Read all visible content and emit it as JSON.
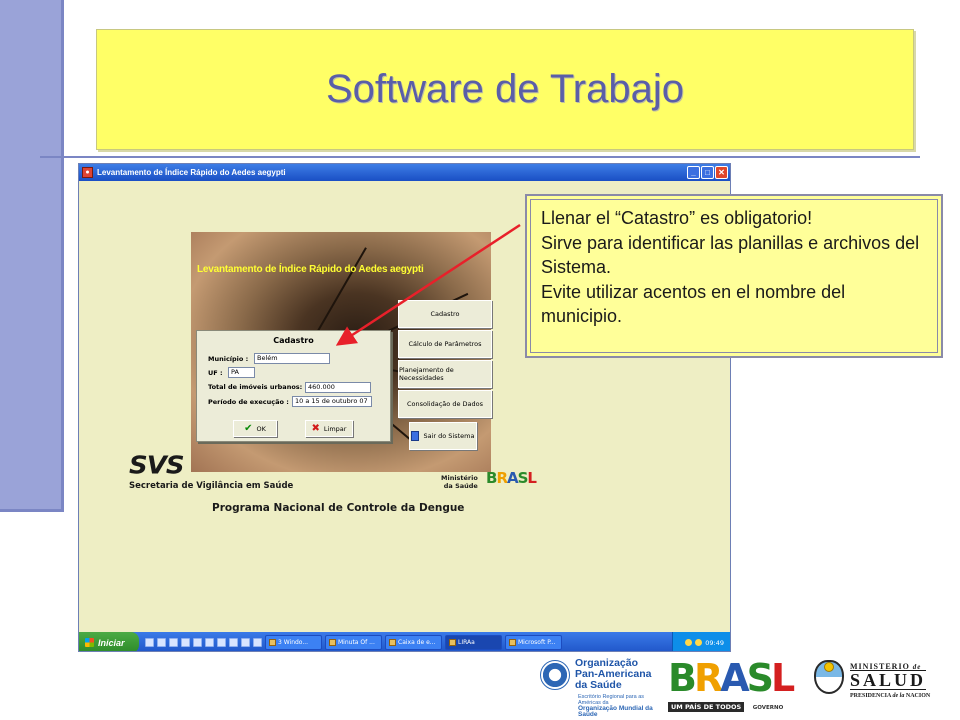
{
  "slide": {
    "title": "Software de Trabajo"
  },
  "window": {
    "title": "Levantamento de Índice Rápido do Aedes aegypti",
    "controls": {
      "minimize": "_",
      "maximize": "□",
      "close": "✕"
    }
  },
  "app": {
    "photo_title": "Levantamento de Índice Rápido do Aedes aegypti",
    "menu": [
      {
        "label": "Cadastro"
      },
      {
        "label": "Cálculo de Parâmetros"
      },
      {
        "label": "Planejamento de Necessidades"
      },
      {
        "label": "Consolidação de Dados"
      },
      {
        "label": "Sair do Sistema"
      }
    ],
    "dialog": {
      "title": "Cadastro",
      "fields": [
        {
          "label": "Município :",
          "value": "Belém"
        },
        {
          "label": "UF :",
          "value": "PA"
        },
        {
          "label": "Total de imóveis urbanos:",
          "value": "460.000"
        },
        {
          "label": "Período de execução :",
          "value": "10 a 15 de outubro 07"
        }
      ],
      "ok_label": "OK",
      "clear_label": "Limpar"
    },
    "svs_logo": "SVS",
    "svs_subtitle": "Secretaria de Vigilância em Saúde",
    "ministerio": [
      "Ministério",
      "da Saúde"
    ],
    "brasil_small": "BRASL",
    "program": "Programa Nacional de Controle da Dengue"
  },
  "taskbar": {
    "start_label": "Iniciar",
    "tasks": [
      {
        "label": "3 Windo..."
      },
      {
        "label": "Minuta Of ..."
      },
      {
        "label": "Caixa de e..."
      },
      {
        "label": "LIRAa"
      },
      {
        "label": "Microsoft P..."
      }
    ],
    "clock": "09:49"
  },
  "callout": {
    "lines": [
      "Llenar el “Catastro” es obligatorio!",
      "Sirve para identificar las planillas e archivos del Sistema.",
      "Evite utilizar acentos en el nombre del municipio."
    ]
  },
  "logos": {
    "opas": [
      "Organização",
      "Pan-Americana",
      "da Saúde"
    ],
    "opas_sub1": "Escritório Regional para as Américas da",
    "opas_sub2": "Organização Mundial da Saúde",
    "brasil": "BRASL",
    "brasil_tagline": "UM PAÍS DE TODOS",
    "brasil_gov": "GOVERNO FEDERAL",
    "salud_ministerio": "MINISTERIO",
    "salud_de": "de",
    "salud_word": "SALUD",
    "salud_pres_1": "PRESIDENCIA",
    "salud_pres_de": "de la",
    "salud_pres_2": "NACION"
  },
  "colors": {
    "title_bg": "#ffff66",
    "title_text": "#5a5ea8",
    "sidebar_accent": "#9aa3d8",
    "callout_bg": "#ffff99",
    "arrow": "#e8202a"
  }
}
